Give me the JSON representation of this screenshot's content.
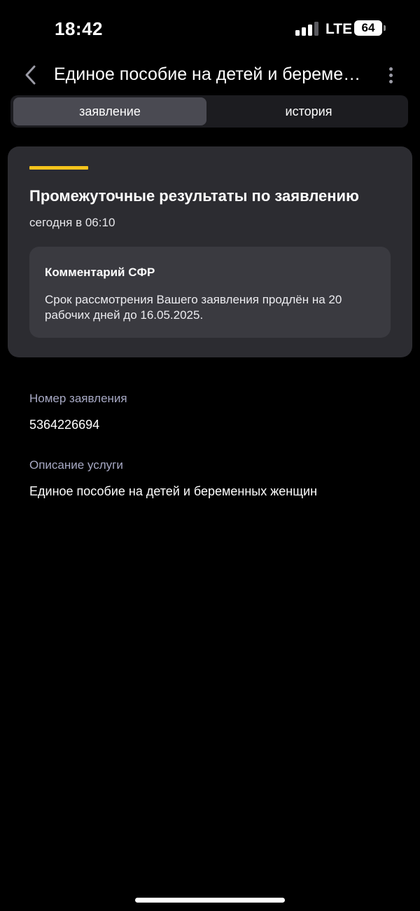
{
  "status_bar": {
    "time": "18:42",
    "network": "LTE",
    "battery": "64",
    "signal_icon": "signal-bars-icon",
    "battery_icon": "battery-icon"
  },
  "header": {
    "back_icon": "chevron-left-icon",
    "title": "Единое пособие на детей и беременных женщин",
    "more_icon": "more-vertical-icon"
  },
  "tabs": [
    {
      "label": "заявление",
      "active": true
    },
    {
      "label": "история",
      "active": false
    }
  ],
  "result_card": {
    "accent_color": "#f7c41c",
    "title": "Промежуточные результаты по заявлению",
    "time": "сегодня в 06:10",
    "comment": {
      "title": "Комментарий СФР",
      "text": "Срок рассмотрения Вашего заявления продлён на 20 рабочих дней до 16.05.2025."
    }
  },
  "details": {
    "number": {
      "label": "Номер заявления",
      "value": "5364226694"
    },
    "service": {
      "label": "Описание услуги",
      "value": "Единое пособие на детей и беременных женщин"
    }
  },
  "colors": {
    "background": "#000000",
    "card": "#2c2c31",
    "comment_box": "#3a3a40",
    "label": "#a7a9c4"
  }
}
